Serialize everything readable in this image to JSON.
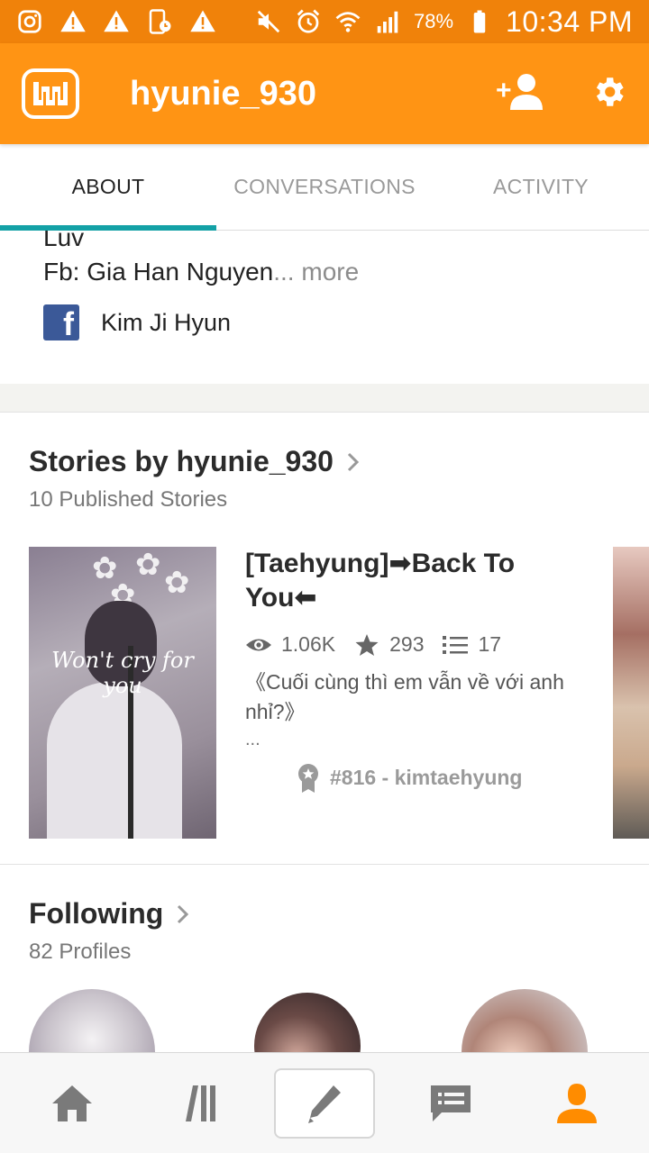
{
  "status_bar": {
    "battery": "78%",
    "time": "10:34 PM"
  },
  "app_bar": {
    "title": "hyunie_930"
  },
  "tabs": [
    {
      "label": "ABOUT",
      "active": true
    },
    {
      "label": "CONVERSATIONS",
      "active": false
    },
    {
      "label": "ACTIVITY",
      "active": false
    }
  ],
  "about": {
    "bio_cut_line": "Luv",
    "bio_line": "Fb: Gia Han Nguyen",
    "more_label": "... more",
    "facebook_name": "Kim Ji Hyun"
  },
  "stories": {
    "heading": "Stories by hyunie_930",
    "subheading": "10 Published Stories",
    "items": [
      {
        "title": "[Taehyung]➡Back To You⬅",
        "reads": "1.06K",
        "votes": "293",
        "parts": "17",
        "description": "《Cuối cùng thì em vẫn về với anh nhỉ?》",
        "ellipsis": "...",
        "rank": "#816 - kimtaehyung",
        "cover_text": "Won't cry for you"
      }
    ]
  },
  "following": {
    "heading": "Following",
    "subheading": "82 Profiles"
  },
  "colors": {
    "status_bar": "#f0820a",
    "app_bar": "#ff9414",
    "tab_indicator": "#13a1a6",
    "nav_active": "#ff8c00"
  }
}
